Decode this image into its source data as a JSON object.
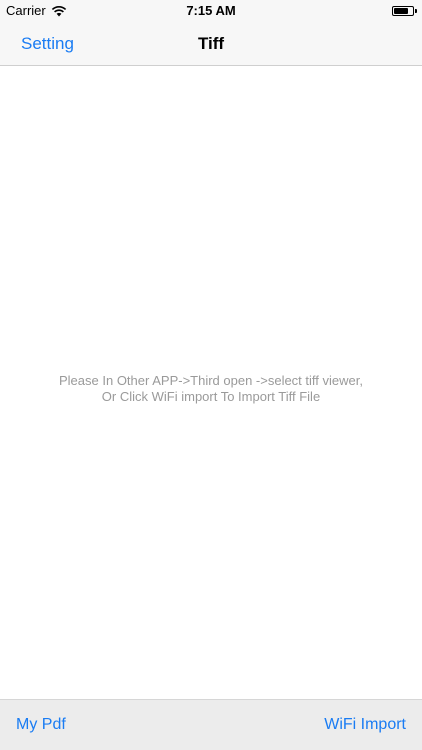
{
  "status_bar": {
    "carrier": "Carrier",
    "time": "7:15 AM",
    "wifi_icon": "wifi-icon",
    "battery_icon": "battery-icon"
  },
  "nav": {
    "left_button": "Setting",
    "title": "Tiff"
  },
  "content": {
    "empty_line_1": "Please In Other APP->Third open ->select tiff viewer,",
    "empty_line_2": "Or Click WiFi import To Import Tiff File"
  },
  "toolbar": {
    "left_button": "My Pdf",
    "right_button": "WiFi Import"
  },
  "colors": {
    "accent": "#1a7cf3",
    "bar_background": "#f7f7f7",
    "toolbar_background": "#ececec",
    "hint_text": "#9a9a9a"
  }
}
